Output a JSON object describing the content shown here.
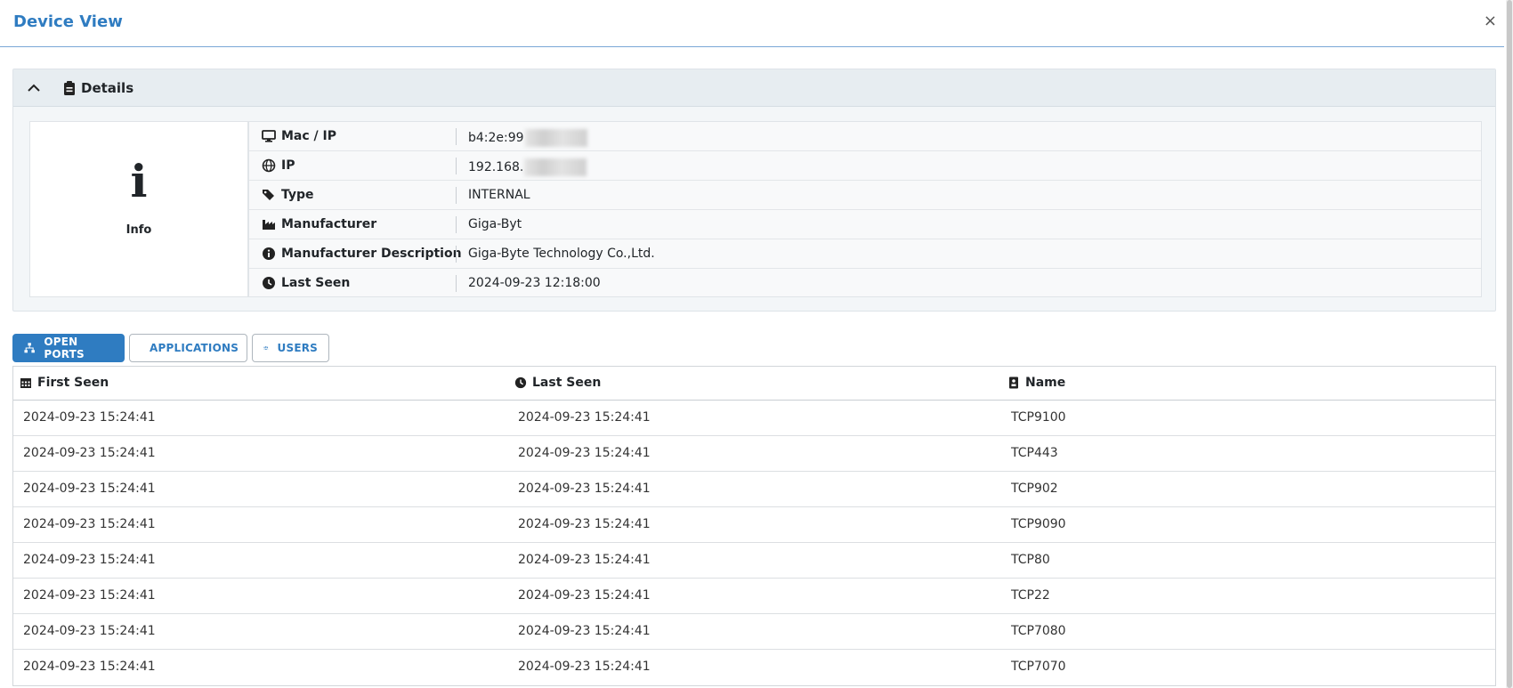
{
  "modal": {
    "title": "Device View",
    "close_label": "×"
  },
  "details": {
    "header_label": "Details",
    "info_glyph": "i",
    "info_label": "Info",
    "rows": [
      {
        "icon": "monitor-icon",
        "label": "Mac / IP",
        "value": "b4:2e:99"
      },
      {
        "icon": "globe-icon",
        "label": "IP",
        "value": "192.168."
      },
      {
        "icon": "tags-icon",
        "label": "Type",
        "value": "INTERNAL"
      },
      {
        "icon": "industry-icon",
        "label": "Manufacturer",
        "value": "Giga-Byt"
      },
      {
        "icon": "info-circle-icon",
        "label": "Manufacturer Description",
        "value": "Giga-Byte Technology Co.,Ltd."
      },
      {
        "icon": "clock-icon",
        "label": "Last Seen",
        "value": "2024-09-23 12:18:00"
      }
    ]
  },
  "tabs": [
    {
      "label": "OPEN PORTS",
      "icon": "network-icon",
      "active": true
    },
    {
      "label": "APPLICATIONS",
      "icon": "grid-icon",
      "active": false
    },
    {
      "label": "USERS",
      "icon": "users-icon",
      "active": false
    }
  ],
  "ports_table": {
    "columns": [
      "First Seen",
      "Last Seen",
      "Name"
    ],
    "rows": [
      [
        "2024-09-23 15:24:41",
        "2024-09-23 15:24:41",
        "TCP9100"
      ],
      [
        "2024-09-23 15:24:41",
        "2024-09-23 15:24:41",
        "TCP443"
      ],
      [
        "2024-09-23 15:24:41",
        "2024-09-23 15:24:41",
        "TCP902"
      ],
      [
        "2024-09-23 15:24:41",
        "2024-09-23 15:24:41",
        "TCP9090"
      ],
      [
        "2024-09-23 15:24:41",
        "2024-09-23 15:24:41",
        "TCP80"
      ],
      [
        "2024-09-23 15:24:41",
        "2024-09-23 15:24:41",
        "TCP22"
      ],
      [
        "2024-09-23 15:24:41",
        "2024-09-23 15:24:41",
        "TCP7080"
      ],
      [
        "2024-09-23 15:24:41",
        "2024-09-23 15:24:41",
        "TCP7070"
      ]
    ]
  },
  "colors": {
    "accent": "#2f7cc1",
    "header_bg": "#e7edf1",
    "card_bg": "#f3f6f8"
  }
}
